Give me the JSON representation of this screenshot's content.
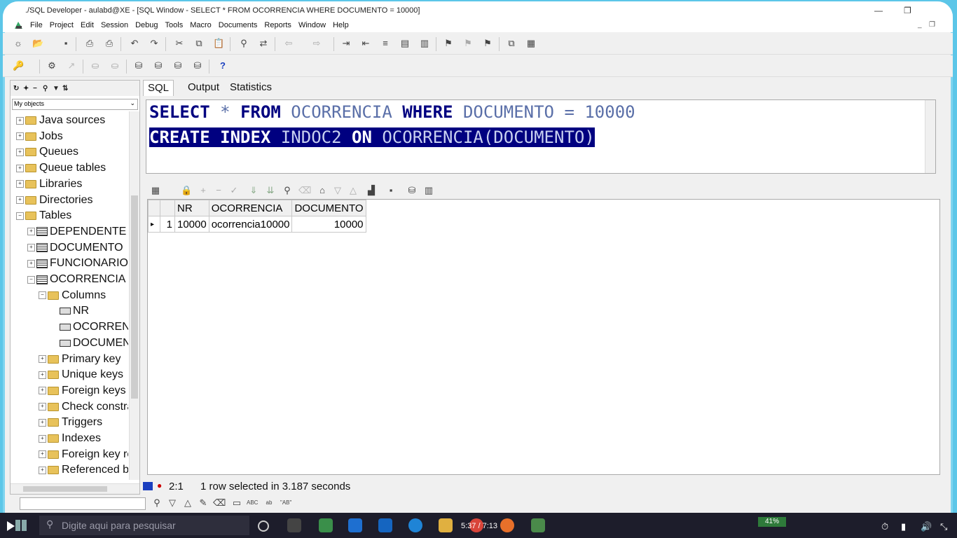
{
  "window": {
    "title": "./SQL Developer - aulabd@XE - [SQL Window - SELECT * FROM OCORRENCIA WHERE DOCUMENTO = 10000]",
    "minimize": "—",
    "restore": "❐"
  },
  "menu": [
    "File",
    "Project",
    "Edit",
    "Session",
    "Debug",
    "Tools",
    "Macro",
    "Documents",
    "Reports",
    "Window",
    "Help"
  ],
  "browser": {
    "filter_value": "My objects",
    "tree": [
      {
        "label": "Java sources",
        "level": 0,
        "kind": "folder"
      },
      {
        "label": "Jobs",
        "level": 0,
        "kind": "folder"
      },
      {
        "label": "Queues",
        "level": 0,
        "kind": "folder"
      },
      {
        "label": "Queue tables",
        "level": 0,
        "kind": "folder"
      },
      {
        "label": "Libraries",
        "level": 0,
        "kind": "folder"
      },
      {
        "label": "Directories",
        "level": 0,
        "kind": "folder"
      },
      {
        "label": "Tables",
        "level": 0,
        "kind": "folder"
      },
      {
        "label": "DEPENDENTE",
        "level": 1,
        "kind": "table"
      },
      {
        "label": "DOCUMENTO",
        "level": 1,
        "kind": "table"
      },
      {
        "label": "FUNCIONARIO",
        "level": 1,
        "kind": "table"
      },
      {
        "label": "OCORRENCIA",
        "level": 1,
        "kind": "table"
      },
      {
        "label": "Columns",
        "level": 2,
        "kind": "folder"
      },
      {
        "label": "NR",
        "level": 3,
        "kind": "column"
      },
      {
        "label": "OCORRENCIA",
        "level": 3,
        "kind": "column"
      },
      {
        "label": "DOCUMENTO",
        "level": 3,
        "kind": "column"
      },
      {
        "label": "Primary key",
        "level": 2,
        "kind": "folder"
      },
      {
        "label": "Unique keys",
        "level": 2,
        "kind": "folder"
      },
      {
        "label": "Foreign keys",
        "level": 2,
        "kind": "folder"
      },
      {
        "label": "Check constraints",
        "level": 2,
        "kind": "folder"
      },
      {
        "label": "Triggers",
        "level": 2,
        "kind": "folder"
      },
      {
        "label": "Indexes",
        "level": 2,
        "kind": "folder"
      },
      {
        "label": "Foreign key references",
        "level": 2,
        "kind": "folder"
      },
      {
        "label": "Referenced by",
        "level": 2,
        "kind": "folder"
      }
    ]
  },
  "tabs": {
    "sql": "SQL",
    "output": "Output",
    "statistics": "Statistics"
  },
  "editor": {
    "line1": {
      "k1": "SELECT",
      "op1": " * ",
      "k2": "FROM",
      "t1": " OCORRENCIA ",
      "k3": "WHERE",
      "t2": " DOCUMENTO = 10000"
    },
    "line2": {
      "k1": "CREATE",
      "k2": " INDEX",
      "t1": " INDOC2 ",
      "k3": "ON",
      "t2": " OCORRENCIA(DOCUMENTO)"
    }
  },
  "results": {
    "columns": [
      "",
      "",
      "NR",
      "OCORRENCIA",
      "DOCUMENTO"
    ],
    "rows": [
      [
        "▸",
        "1",
        "10000",
        "ocorrencia10000",
        "10000"
      ]
    ]
  },
  "status": {
    "position": "2:1",
    "message": "1 row selected in 3.187 seconds"
  },
  "taskbar": {
    "search_placeholder": "Digite aqui para pesquisar",
    "battery": "41%"
  },
  "video": {
    "time": "5:37 / 7:13"
  }
}
